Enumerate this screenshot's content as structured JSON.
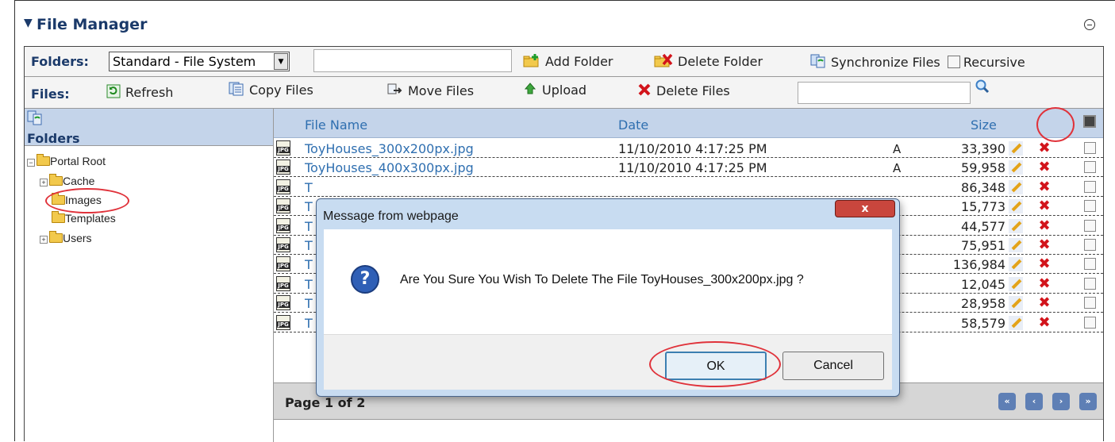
{
  "module": {
    "title": "File Manager"
  },
  "folders_toolbar": {
    "label": "Folders:",
    "folder_select_value": "Standard - File System",
    "add_folder": "Add Folder",
    "delete_folder": "Delete Folder",
    "synchronize_files": "Synchronize Files",
    "recursive": "Recursive"
  },
  "files_toolbar": {
    "label": "Files:",
    "refresh": "Refresh",
    "copy_files": "Copy Files",
    "move_files": "Move Files",
    "upload": "Upload",
    "delete_files": "Delete Files"
  },
  "tree": {
    "header": "Folders",
    "nodes": [
      "Portal Root",
      "Cache",
      "Images",
      "Templates",
      "Users"
    ]
  },
  "grid": {
    "columns": {
      "file_name": "File Name",
      "date": "Date",
      "size": "Size"
    },
    "rows": [
      {
        "name": "ToyHouses_300x200px.jpg",
        "date": "11/10/2010 4:17:25 PM",
        "attr": "A",
        "size": "33,390"
      },
      {
        "name": "ToyHouses_400x300px.jpg",
        "date": "11/10/2010 4:17:25 PM",
        "attr": "A",
        "size": "59,958"
      },
      {
        "name": "T",
        "date": "",
        "attr": "",
        "size": "86,348"
      },
      {
        "name": "T",
        "date": "",
        "attr": "",
        "size": "15,773"
      },
      {
        "name": "T",
        "date": "",
        "attr": "",
        "size": "44,577"
      },
      {
        "name": "T",
        "date": "",
        "attr": "",
        "size": "75,951"
      },
      {
        "name": "T",
        "date": "",
        "attr": "",
        "size": "136,984"
      },
      {
        "name": "T",
        "date": "",
        "attr": "",
        "size": "12,045"
      },
      {
        "name": "T",
        "date": "",
        "attr": "",
        "size": "28,958"
      },
      {
        "name": "T",
        "date": "",
        "attr": "",
        "size": "58,579"
      }
    ],
    "pager_text": "Page 1 of 2",
    "icon_label": "JPG"
  },
  "dialog": {
    "title": "Message from webpage",
    "message": "Are You Sure You Wish To Delete The File ToyHouses_300x200px.jpg ?",
    "ok": "OK",
    "cancel": "Cancel",
    "close_glyph": "x"
  },
  "colors": {
    "accent": "#2f6fb0",
    "header_bg": "#c4d4ea",
    "highlight_ring": "#e0323a"
  }
}
